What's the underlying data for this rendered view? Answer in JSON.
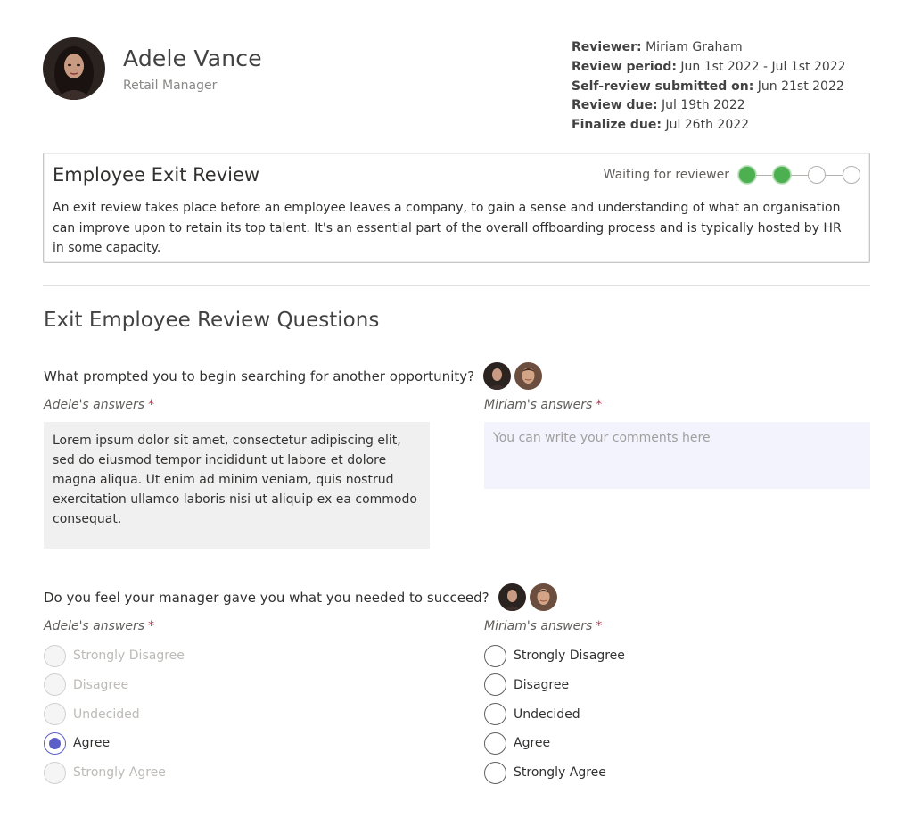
{
  "employee": {
    "name": "Adele Vance",
    "role": "Retail Manager"
  },
  "meta": [
    {
      "key": "Reviewer:",
      "value": "Miriam Graham"
    },
    {
      "key": "Review period:",
      "value": "Jun 1st 2022 - Jul 1st 2022"
    },
    {
      "key": "Self-review submitted on:",
      "value": "Jun 21st 2022"
    },
    {
      "key": "Review due:",
      "value": "Jul 19th 2022"
    },
    {
      "key": "Finalize due:",
      "value": "Jul 26th 2022"
    }
  ],
  "card": {
    "title": "Employee Exit Review",
    "status_label": "Waiting for reviewer",
    "steps_completed": 2,
    "steps_total": 4,
    "description": "An exit review takes place before an employee leaves a company, to gain a sense and understanding of what an organisation can improve upon to retain its top talent. It's an essential part of the overall offboarding process and is typically hosted by HR in some capacity."
  },
  "section_title": "Exit Employee Review Questions",
  "questions": [
    {
      "text": "What prompted you to begin searching for another opportunity?",
      "employee_label": "Adele's answers",
      "reviewer_label": "Miriam's answers",
      "required_mark": "*",
      "employee_answer": "Lorem ipsum dolor sit amet, consectetur adipiscing elit, sed do eiusmod tempor incididunt ut labore et dolore magna aliqua. Ut enim ad minim veniam, quis nostrud exercitation ullamco laboris nisi ut aliquip ex ea commodo consequat.",
      "reviewer_placeholder": "You can write your comments here"
    },
    {
      "text": "Do you feel your manager gave you what you needed to succeed?",
      "employee_label": "Adele's answers",
      "reviewer_label": "Miriam's answers",
      "required_mark": "*",
      "options": [
        "Strongly Disagree",
        "Disagree",
        "Undecided",
        "Agree",
        "Strongly Agree"
      ],
      "employee_selected": "Agree",
      "reviewer_selected": ""
    }
  ],
  "colors": {
    "step_done": "#4caf50",
    "radio_accent": "#5b5fc7",
    "comment_bg": "#f3f3fe",
    "answer_bg": "#f0f0f0",
    "required": "#c4314b"
  }
}
